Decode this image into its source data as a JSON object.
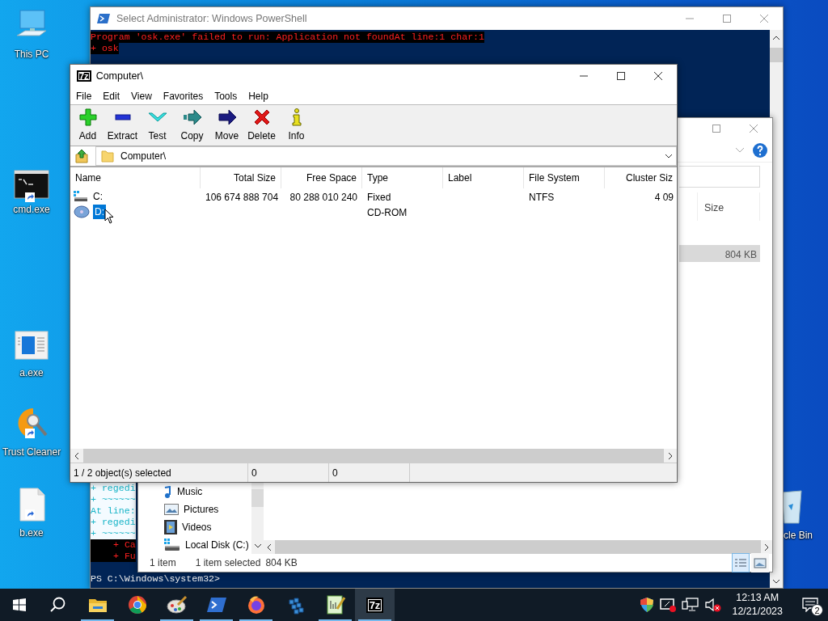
{
  "desktop_icons": [
    {
      "label": "This PC",
      "kind": "pc",
      "shortcut": false
    },
    {
      "label": "cmd.exe",
      "kind": "cmd",
      "shortcut": true
    },
    {
      "label": "a.exe",
      "kind": "app",
      "shortcut": false
    },
    {
      "label": "Trust Cleaner",
      "kind": "cleaner",
      "shortcut": true
    },
    {
      "label": "b.exe",
      "kind": "file",
      "shortcut": true
    },
    {
      "label": "cle Bin",
      "kind": "bin",
      "shortcut": false
    }
  ],
  "powershell": {
    "title": "Select Administrator: Windows PowerShell",
    "lines_top": [
      {
        "text": "Program 'osk.exe' failed to run: Application not foundAt line:1 char:1",
        "kind": "error"
      },
      {
        "text": "+ osk",
        "kind": "error"
      }
    ],
    "lines_bottom": [
      {
        "text": "+ regedi",
        "kind": "info"
      },
      {
        "text": "+ ~~~~~~",
        "kind": "info"
      },
      {
        "text": "At line:",
        "kind": "info"
      },
      {
        "text": "+ regedi",
        "kind": "info"
      },
      {
        "text": "+ ~~~~~~",
        "kind": "info"
      },
      {
        "text": "+ Ca",
        "kind": "detail"
      },
      {
        "text": "+ Fu",
        "kind": "detail"
      }
    ],
    "prompt": "PS C:\\Windows\\system32>"
  },
  "explorer": {
    "nav_items": [
      {
        "label": "Music",
        "kind": "music"
      },
      {
        "label": "Pictures",
        "kind": "pictures"
      },
      {
        "label": "Videos",
        "kind": "videos"
      },
      {
        "label": "Local Disk (C:)",
        "kind": "disk"
      }
    ],
    "column": "Size",
    "row": {
      "size": "804 KB",
      "selected": true
    },
    "status": {
      "count": "1 item",
      "selected": "1 item selected",
      "size": "804 KB"
    },
    "views": [
      {
        "kind": "details",
        "selected": true
      },
      {
        "kind": "large",
        "selected": false
      }
    ]
  },
  "sevenzip": {
    "logo": "7z",
    "title": "Computer\\",
    "menu": [
      "File",
      "Edit",
      "View",
      "Favorites",
      "Tools",
      "Help"
    ],
    "toolbar": [
      {
        "label": "Add",
        "kind": "add"
      },
      {
        "label": "Extract",
        "kind": "extract"
      },
      {
        "label": "Test",
        "kind": "test"
      },
      {
        "label": "Copy",
        "kind": "copy"
      },
      {
        "label": "Move",
        "kind": "move"
      },
      {
        "label": "Delete",
        "kind": "delete"
      },
      {
        "label": "Info",
        "kind": "info"
      }
    ],
    "address": "Computer\\",
    "columns": [
      "Name",
      "Total Size",
      "Free Space",
      "Type",
      "Label",
      "File System",
      "Cluster Siz"
    ],
    "rows": [
      {
        "name": "C:",
        "kind": "disk",
        "selected": false,
        "total_size": "106 674 888 704",
        "free_space": "80 288 010 240",
        "type": "Fixed",
        "file_system": "NTFS",
        "cluster_size": "4 09"
      },
      {
        "name": "D:",
        "kind": "cdrom",
        "selected": true,
        "type": "CD-ROM"
      }
    ],
    "status": [
      "1 / 2 object(s) selected",
      "0",
      "0"
    ]
  },
  "taskbar": {
    "apps": [
      {
        "kind": "explorer",
        "running": true,
        "active": false
      },
      {
        "kind": "chrome",
        "running": false,
        "active": false
      },
      {
        "kind": "paint",
        "running": true,
        "active": false
      },
      {
        "kind": "powershell",
        "running": true,
        "active": false
      },
      {
        "kind": "firefox",
        "running": true,
        "active": false
      },
      {
        "kind": "registry",
        "running": false,
        "active": false
      },
      {
        "kind": "notepad",
        "running": true,
        "active": false
      },
      {
        "kind": "sevenzip",
        "running": true,
        "active": true,
        "logo": "7z"
      }
    ],
    "time": "12:13 AM",
    "date": "12/21/2023",
    "notifications": "2"
  }
}
